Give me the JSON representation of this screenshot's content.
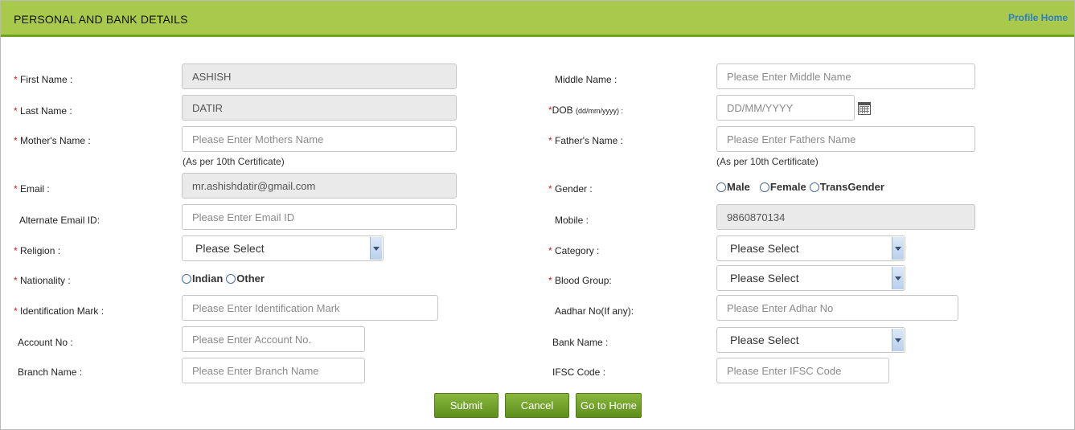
{
  "header": {
    "title": "PERSONAL AND BANK DETAILS",
    "profile_home": "Profile Home"
  },
  "left": {
    "first_name": {
      "label": "First Name :",
      "value": "ASHISH"
    },
    "last_name": {
      "label": "Last Name :",
      "value": "DATIR"
    },
    "mother_name": {
      "label": "Mother's Name :",
      "placeholder": "Please Enter Mothers Name",
      "note": "(As per 10th Certificate)"
    },
    "email": {
      "label": "Email :",
      "value": "mr.ashishdatir@gmail.com"
    },
    "alt_email": {
      "label": "Alternate Email ID:",
      "placeholder": "Please Enter Email ID"
    },
    "religion": {
      "label": "Religion :",
      "selected": "Please Select"
    },
    "nationality": {
      "label": "Nationality :",
      "options": [
        "Indian",
        "Other"
      ]
    },
    "identification": {
      "label": "Identification Mark :",
      "placeholder": "Please Enter Identification Mark"
    },
    "account_no": {
      "label": "Account No :",
      "placeholder": "Please Enter Account No."
    },
    "branch_name": {
      "label": "Branch Name :",
      "placeholder": "Please Enter Branch Name"
    }
  },
  "right": {
    "middle_name": {
      "label": "Middle Name :",
      "placeholder": "Please Enter Middle Name"
    },
    "dob": {
      "label": "DOB",
      "format": "(dd/mm/yyyy) :",
      "placeholder": "DD/MM/YYYY"
    },
    "father_name": {
      "label": "Father's Name :",
      "placeholder": "Please Enter Fathers Name",
      "note": "(As per 10th Certificate)"
    },
    "gender": {
      "label": "Gender :",
      "options": [
        "Male",
        "Female",
        "TransGender"
      ]
    },
    "mobile": {
      "label": "Mobile :",
      "value": "9860870134"
    },
    "category": {
      "label": "Category :",
      "selected": "Please Select"
    },
    "blood_group": {
      "label": "Blood Group:",
      "selected": "Please Select"
    },
    "aadhar": {
      "label": "Aadhar No(If any):",
      "placeholder": "Please Enter Adhar No"
    },
    "bank_name": {
      "label": "Bank Name :",
      "selected": "Please Select"
    },
    "ifsc": {
      "label": "IFSC Code :",
      "placeholder": "Please Enter IFSC Code"
    }
  },
  "buttons": {
    "submit": "Submit",
    "cancel": "Cancel",
    "home": "Go to Home"
  },
  "colors": {
    "header_bg": "#a9c94c",
    "header_border": "#6fa31f",
    "button": "#6e9f26",
    "link": "#2b7ec1",
    "required": "#d21a1a"
  }
}
